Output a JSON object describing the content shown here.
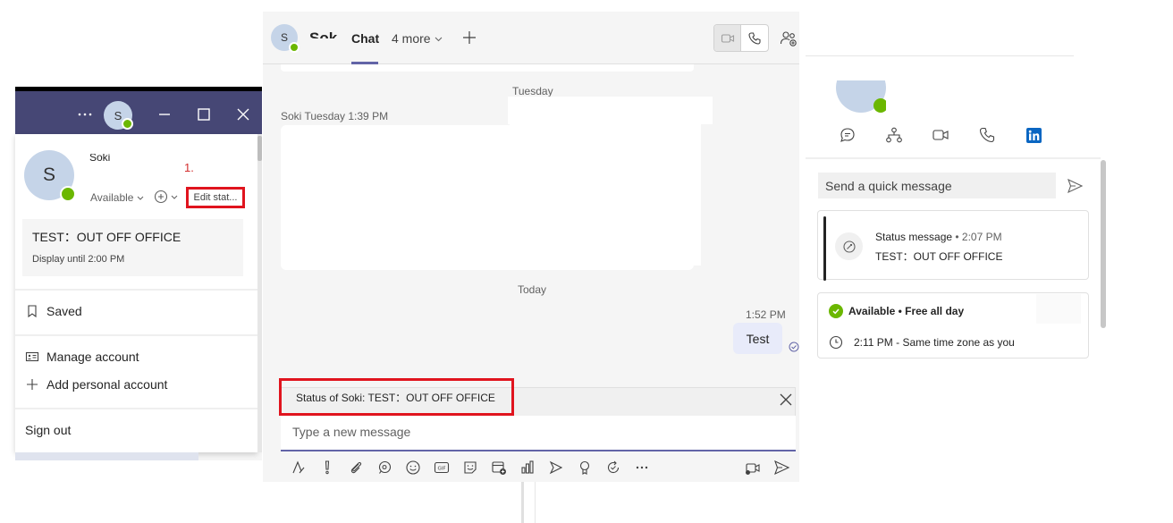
{
  "left_window": {
    "titlebar": {
      "more_label": "···",
      "avatar_initial": "S"
    },
    "profile": {
      "avatar_initial": "S",
      "name": "Soki",
      "availability": "Available",
      "edit_status_label": "Edit stat...",
      "annotation_step": "1."
    },
    "status_card": {
      "message": "TEST：OUT OFF OFFICE",
      "expiry": "Display until 2:00 PM"
    },
    "menu": {
      "saved": "Saved",
      "manage_account": "Manage account",
      "add_personal_account": "Add personal account",
      "sign_out": "Sign out"
    }
  },
  "chat": {
    "avatar_initial": "S",
    "contact_name": "Soki",
    "tab_active": "Chat",
    "tab_more": "4 more",
    "date_tuesday": "Tuesday",
    "message_1_meta": "Soki   Tuesday 1:39 PM",
    "date_today": "Today",
    "message_2_time": "1:52 PM",
    "message_2_text": "Test",
    "status_banner": "Status of Soki: TEST：OUT OFF OFFICE",
    "compose_placeholder": "Type a new message"
  },
  "profile_card": {
    "quick_message_placeholder": "Send a quick message",
    "status_message_label": "Status message",
    "status_message_time": "• 2:07 PM",
    "status_message_text": "TEST：OUT OFF OFFICE",
    "availability": "Available • Free all day",
    "local_time": "2:11 PM - Same time zone as you"
  },
  "colors": {
    "titlebar": "#464775",
    "accent": "#6264a7",
    "presence_available": "#6bb700",
    "annotation_red": "#e0141e",
    "linkedin": "#0a66c2"
  },
  "icons": {
    "titlebar": [
      "more-icon",
      "minimize-icon",
      "maximize-icon",
      "close-icon"
    ],
    "menu": [
      "bookmark-icon",
      "id-card-icon",
      "plus-icon"
    ],
    "chat_header": [
      "video-icon",
      "phone-icon",
      "people-add-icon",
      "plus-icon",
      "chevron-down-icon"
    ],
    "compose": [
      "format-icon",
      "priority-icon",
      "attach-icon",
      "loop-icon",
      "emoji-icon",
      "gif-icon",
      "sticker-icon",
      "schedule-meeting-icon",
      "chart-icon",
      "stream-icon",
      "praise-icon",
      "approvals-icon",
      "more-icon",
      "video-clip-icon",
      "send-icon"
    ],
    "profile_card": [
      "chat-icon",
      "org-chart-icon",
      "video-icon",
      "phone-icon",
      "linkedin-icon",
      "send-icon",
      "status-message-icon",
      "available-check-icon",
      "clock-icon"
    ]
  }
}
